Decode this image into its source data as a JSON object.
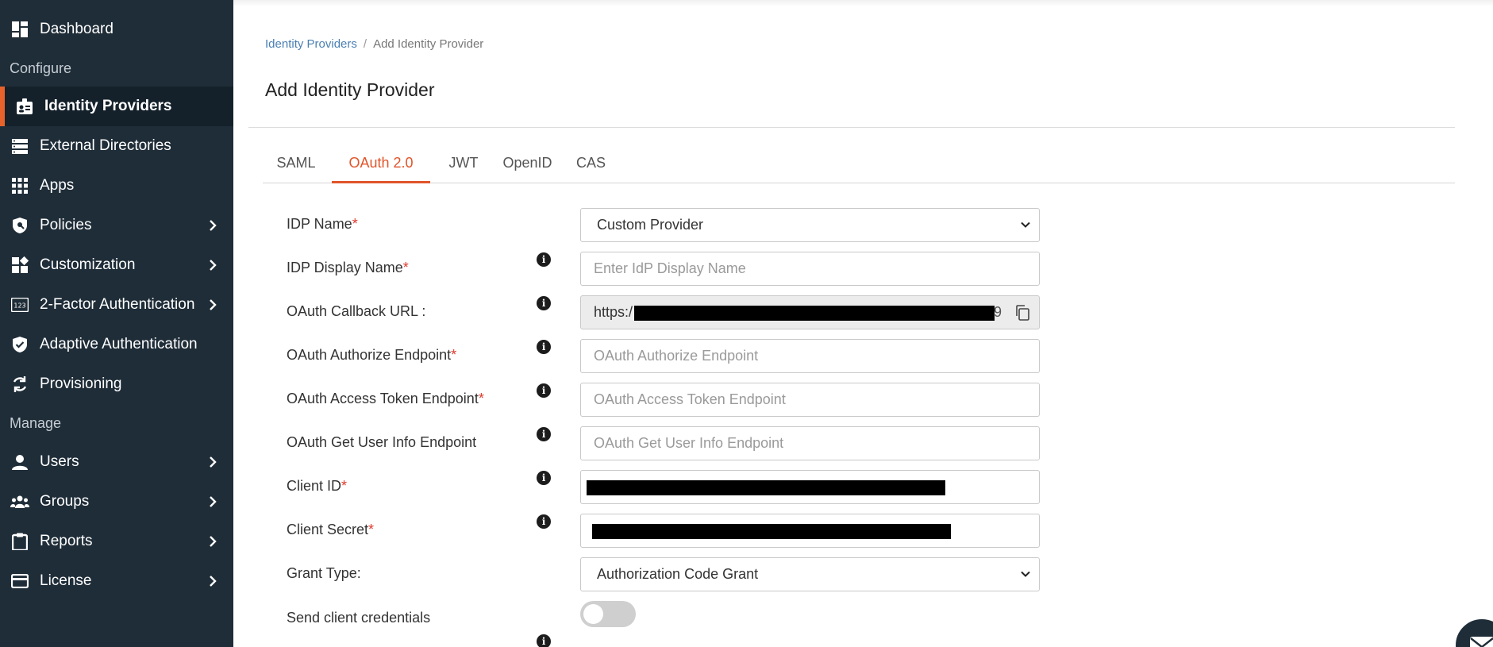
{
  "sidebar": {
    "items": [
      {
        "label": "Dashboard",
        "icon": "dashboard-icon"
      },
      {
        "label": "Identity Providers",
        "icon": "id-badge-icon",
        "active": true
      },
      {
        "label": "External Directories",
        "icon": "directory-list-icon"
      },
      {
        "label": "Apps",
        "icon": "apps-grid-icon"
      },
      {
        "label": "Policies",
        "icon": "shield-policy-icon",
        "has_submenu": true
      },
      {
        "label": "Customization",
        "icon": "customization-icon",
        "has_submenu": true
      },
      {
        "label": "2-Factor Authentication",
        "icon": "two-factor-icon",
        "has_submenu": true
      },
      {
        "label": "Adaptive Authentication",
        "icon": "shield-check-icon"
      },
      {
        "label": "Provisioning",
        "icon": "sync-icon"
      },
      {
        "label": "Users",
        "icon": "user-icon",
        "has_submenu": true
      },
      {
        "label": "Groups",
        "icon": "groups-icon",
        "has_submenu": true
      },
      {
        "label": "Reports",
        "icon": "clipboard-icon",
        "has_submenu": true
      },
      {
        "label": "License",
        "icon": "credit-card-icon",
        "has_submenu": true
      }
    ],
    "sections": {
      "configure": "Configure",
      "manage": "Manage"
    }
  },
  "breadcrumb": {
    "parent": "Identity Providers",
    "separator": "/",
    "current": "Add Identity Provider"
  },
  "page_title": "Add Identity Provider",
  "tabs": [
    {
      "label": "SAML"
    },
    {
      "label": "OAuth 2.0",
      "active": true
    },
    {
      "label": "JWT"
    },
    {
      "label": "OpenID"
    },
    {
      "label": "CAS"
    }
  ],
  "form": {
    "idp_name": {
      "label": "IDP Name",
      "required_mark": "*",
      "value": "Custom Provider"
    },
    "idp_display_name": {
      "label": "IDP Display Name",
      "required_mark": "*",
      "placeholder": "Enter IdP Display Name"
    },
    "callback_url": {
      "label": "OAuth Callback URL :",
      "value_prefix": "https:/",
      "value_suffix": "09"
    },
    "authorize_endpoint": {
      "label": "OAuth Authorize Endpoint",
      "required_mark": "*",
      "placeholder": "OAuth Authorize Endpoint"
    },
    "access_token_endpoint": {
      "label": "OAuth Access Token Endpoint",
      "required_mark": "*",
      "placeholder": "OAuth Access Token Endpoint"
    },
    "user_info_endpoint": {
      "label": "OAuth Get User Info Endpoint",
      "placeholder": "OAuth Get User Info Endpoint"
    },
    "client_id": {
      "label": "Client ID",
      "required_mark": "*"
    },
    "client_secret": {
      "label": "Client Secret",
      "required_mark": "*"
    },
    "grant_type": {
      "label": "Grant Type:",
      "value": "Authorization Code Grant"
    },
    "send_client_credentials": {
      "label": "Send client credentials",
      "enabled": false
    }
  },
  "colors": {
    "sidebar_bg": "#1f2d38",
    "sidebar_active_bg": "#14212b",
    "accent": "#e8632b",
    "link": "#4a7fb3",
    "required": "#e03a2e"
  }
}
